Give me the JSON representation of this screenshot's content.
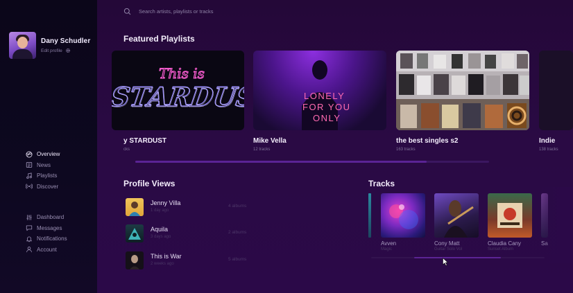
{
  "search": {
    "placeholder": "Search artists, playlists or tracks"
  },
  "profile": {
    "name": "Dany Schudler",
    "edit_label": "Edit profile"
  },
  "nav": {
    "primary": [
      {
        "label": "Overview",
        "icon": "globe-icon",
        "active": true
      },
      {
        "label": "News",
        "icon": "news-icon",
        "active": false
      },
      {
        "label": "Playlists",
        "icon": "music-note-icon",
        "active": false
      },
      {
        "label": "Discover",
        "icon": "radio-icon",
        "active": false
      }
    ],
    "secondary": [
      {
        "label": "Dashboard",
        "icon": "sliders-icon"
      },
      {
        "label": "Messages",
        "icon": "chat-bubble-icon"
      },
      {
        "label": "Notifications",
        "icon": "bell-icon"
      },
      {
        "label": "Account",
        "icon": "user-icon"
      }
    ]
  },
  "featured": {
    "title": "Featured Playlists",
    "playlists": [
      {
        "name": "y STARDUST",
        "count": "cks",
        "art_text_1": "This is",
        "art_text_2": "STARDUST"
      },
      {
        "name": "Mike Vella",
        "count": "12 tracks",
        "art_text_1": "LONELY",
        "art_text_2": "FOR YOU",
        "art_text_3": "ONLY"
      },
      {
        "name": "the best singles s2",
        "count": "163 tracks"
      },
      {
        "name": "Indie",
        "count": "138 tracks"
      }
    ]
  },
  "profile_views": {
    "title": "Profile Views",
    "rows": [
      {
        "name": "Jenny Villa",
        "time": "1 day ago",
        "albums": "4 albums"
      },
      {
        "name": "Aquila",
        "time": "3 days ago",
        "albums": "2 albums"
      },
      {
        "name": "This is War",
        "time": "2 weeks ago",
        "albums": "5 albums"
      }
    ]
  },
  "tracks": {
    "title": "Tracks",
    "items": [
      {
        "name": "Avven",
        "sub": "Magic"
      },
      {
        "name": "Cony Matt",
        "sub": "Guitar Solo Vol"
      },
      {
        "name": "Claudia Cany",
        "sub": "Sunset Album"
      },
      {
        "name": "Sa",
        "sub": ""
      }
    ]
  },
  "colors": {
    "sidebar_bg": "#0b0619",
    "main_bg": "#2a0a44",
    "accent": "#5a2395",
    "neon_pink": "#ff4fd8",
    "neon_blue": "#8a7bff"
  }
}
